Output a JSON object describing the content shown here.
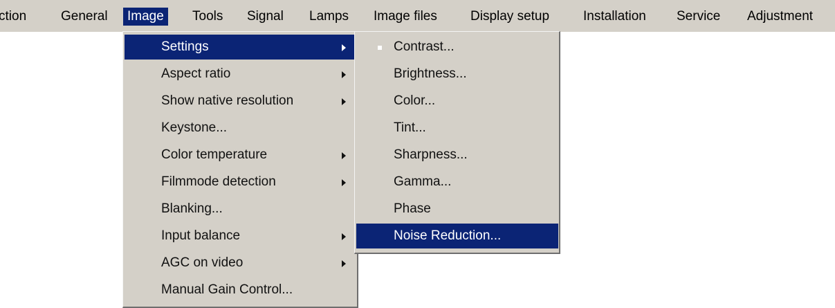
{
  "menubar": {
    "items": [
      "ction",
      "General",
      "Image",
      "Tools",
      "Signal",
      "Lamps",
      "Image files",
      "Display setup",
      "Installation",
      "Service",
      "Adjustment"
    ],
    "active": "Image"
  },
  "image_menu": {
    "items": [
      {
        "label": "Settings",
        "has_submenu": true,
        "selected": true
      },
      {
        "label": "Aspect ratio",
        "has_submenu": true
      },
      {
        "label": "Show native resolution",
        "has_submenu": true
      },
      {
        "label": "Keystone...",
        "has_submenu": false
      },
      {
        "label": "Color temperature",
        "has_submenu": true
      },
      {
        "label": "Filmmode detection",
        "has_submenu": true
      },
      {
        "label": "Blanking...",
        "has_submenu": false
      },
      {
        "label": "Input balance",
        "has_submenu": true
      },
      {
        "label": "AGC on video",
        "has_submenu": true
      },
      {
        "label": "Manual Gain Control...",
        "has_submenu": false
      }
    ]
  },
  "settings_submenu": {
    "items": [
      {
        "label": "Contrast...",
        "checked": true
      },
      {
        "label": "Brightness..."
      },
      {
        "label": "Color..."
      },
      {
        "label": "Tint..."
      },
      {
        "label": "Sharpness..."
      },
      {
        "label": "Gamma..."
      },
      {
        "label": "Phase"
      },
      {
        "label": "Noise Reduction...",
        "selected": true
      }
    ]
  },
  "colors": {
    "menu_bg": "#d4d0c8",
    "highlight": "#0b2475",
    "highlight_text": "#ffffff"
  }
}
